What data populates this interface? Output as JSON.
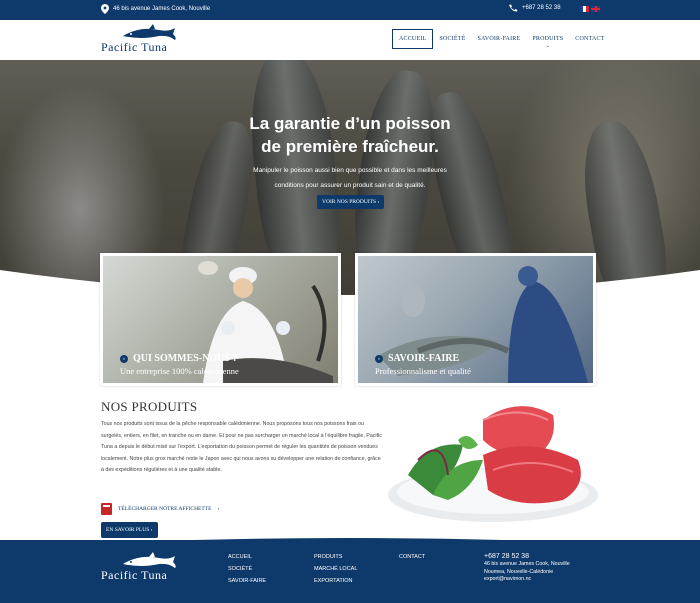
{
  "topbar": {
    "address": "46 bis avenue James Cook, Nouville",
    "phone": "+687 28 52 38"
  },
  "brand": {
    "name": "Pacific Tuna"
  },
  "nav": [
    {
      "label": "ACCUEIL",
      "active": true
    },
    {
      "label": "SOCIÉTÉ"
    },
    {
      "label": "SAVOIR-FAIRE"
    },
    {
      "label": "PRODUITS",
      "dropdown": true
    },
    {
      "label": "CONTACT"
    }
  ],
  "hero": {
    "title_line1": "La garantie d’un poisson",
    "title_line2": "de première fraîcheur.",
    "subtitle": "Manipuler le poisson aussi bien que possible et dans les meilleures conditions pour assurer un produit sain et de qualité.",
    "button": "VOIR NOS PRODUITS"
  },
  "cards": [
    {
      "title": "QUI SOMMES-NOUS ?",
      "subtitle": "Une entreprise 100% calédonienne"
    },
    {
      "title": "SAVOIR-FAIRE",
      "subtitle": "Professionnalisme et qualité"
    }
  ],
  "products": {
    "title": "NOS PRODUITS",
    "text": "Tous nos produits sont issus de la pêche responsable calédonienne. Nous proposons tous nos poissons frais ou surgelés, entiers, en filet, en tranche ou en darne. Et pour ne pas surcharger un marché local à l’équilibre fragile, Pacific Tuna a depuis le début misé sur l’export. L’exportation du poisson permet de réguler les quantités de poisson vendues localement. Notre plus gros marché reste le Japon avec qui nous avons su développer une relation de confiance, grâce à des expéditions régulières et à une qualité stable.",
    "download_label": "TÉLÉCHARGER NOTRE AFFICHETTE",
    "more_button": "EN SAVOIR PLUS"
  },
  "footer": {
    "col1": [
      "ACCUEIL",
      "SOCIÉTÉ",
      "SAVOIR-FAIRE"
    ],
    "col2": [
      "PRODUITS",
      "MARCHÉ LOCAL",
      "EXPORTATION"
    ],
    "col3": [
      "CONTACT"
    ],
    "phone": "+687 28 52 38",
    "address_line1": "46 bis avenue James Cook, Nouville",
    "address_line2": "Noumea, Nouvelle-Calédonie",
    "email": "export@navimon.nc"
  },
  "colors": {
    "brand_blue": "#0d3a6b",
    "accent_red": "#c62828"
  }
}
